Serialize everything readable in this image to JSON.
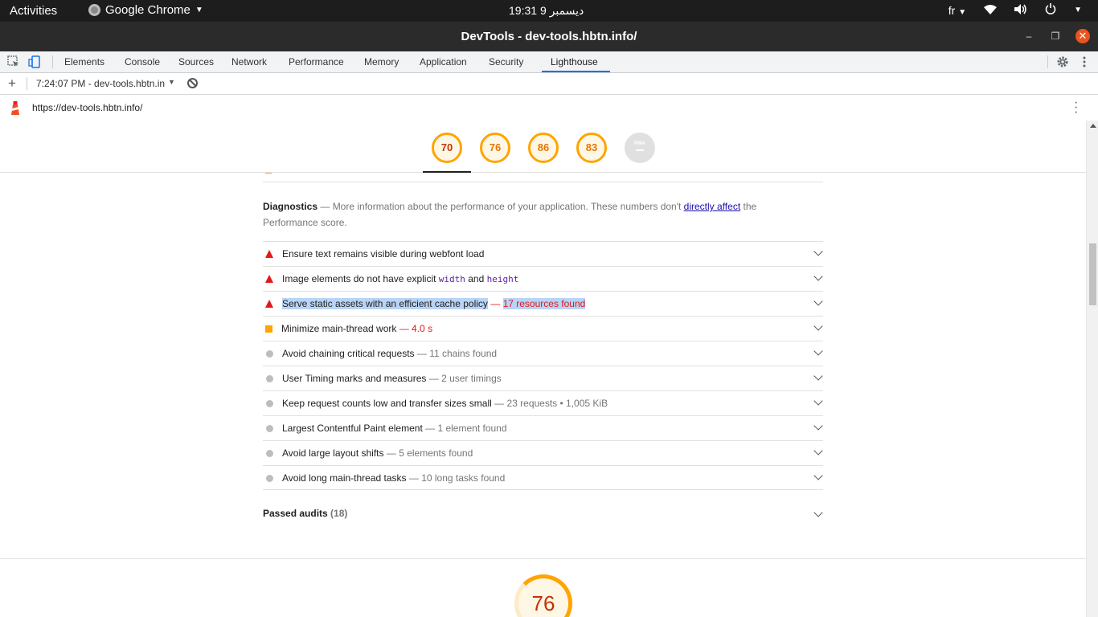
{
  "system_bar": {
    "activities": "Activities",
    "app_name": "Google Chrome",
    "clock": "19:31  ديسمبر 9",
    "language": "fr"
  },
  "window": {
    "title": "DevTools - dev-tools.hbtn.info/"
  },
  "devtools_tabs": [
    "Elements",
    "Console",
    "Sources",
    "Network",
    "Performance",
    "Memory",
    "Application",
    "Security",
    "Lighthouse"
  ],
  "active_tab": "Lighthouse",
  "lighthouse_toolbar": {
    "report_label": "7:24:07 PM - dev-tools.hbtn.in"
  },
  "url": "https://dev-tools.hbtn.info/",
  "gauges": [
    {
      "value": "70",
      "color": "#ffa400"
    },
    {
      "value": "76",
      "color": "#ffa400"
    },
    {
      "value": "86",
      "color": "#ffa400"
    },
    {
      "value": "83",
      "color": "#ffa400"
    },
    {
      "value": "PWA",
      "color": "#e0e0e0"
    }
  ],
  "diagnostics": {
    "heading": "Diagnostics",
    "dash": " — ",
    "text_before_link": "More information about the performance of your application. These numbers don't ",
    "link": "directly affect",
    "text_after_link": " the Performance score."
  },
  "audits": [
    {
      "status": "fail",
      "title": "Ensure text remains visible during webfont load",
      "display": ""
    },
    {
      "status": "fail",
      "title_parts": [
        "Image elements do not have explicit ",
        "width",
        " and ",
        "height"
      ],
      "display": ""
    },
    {
      "status": "fail",
      "title": "Serve static assets with an efficient cache policy",
      "display": "17 resources found",
      "selected": true
    },
    {
      "status": "average",
      "title": "Minimize main-thread work",
      "display": "4.0 s"
    },
    {
      "status": "info",
      "title": "Avoid chaining critical requests",
      "display": "11 chains found"
    },
    {
      "status": "info",
      "title": "User Timing marks and measures",
      "display": "2 user timings"
    },
    {
      "status": "info",
      "title": "Keep request counts low and transfer sizes small",
      "display": "23 requests • 1,005 KiB"
    },
    {
      "status": "info",
      "title": "Largest Contentful Paint element",
      "display": "1 element found"
    },
    {
      "status": "info",
      "title": "Avoid large layout shifts",
      "display": "5 elements found"
    },
    {
      "status": "info",
      "title": "Avoid long main-thread tasks",
      "display": "10 long tasks found"
    }
  ],
  "passed_audits": {
    "label": "Passed audits",
    "count": "(18)"
  },
  "next_category_score": "76",
  "colors": {
    "fail": "#e31919",
    "average": "#ffa400",
    "info": "#bdbdbd",
    "accent": "#1a73e8"
  }
}
